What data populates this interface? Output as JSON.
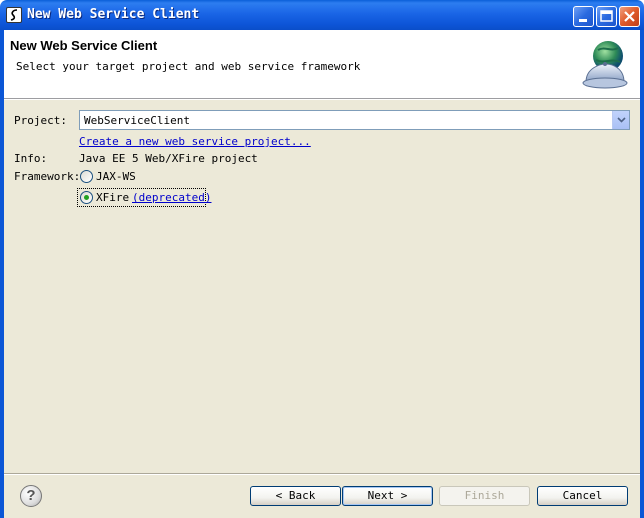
{
  "window": {
    "title": "New Web Service Client"
  },
  "header": {
    "title": "New Web Service Client",
    "description": "Select your target project and web service framework",
    "logo_icon": "globe-with-bell-icon"
  },
  "form": {
    "project_label": "Project:",
    "project_value": "WebServiceClient",
    "create_link": "Create a new web service project...",
    "info_label": "Info:",
    "info_value": "Java EE 5 Web/XFire project",
    "framework_label": "Framework:",
    "framework_options": [
      {
        "label": "JAX-WS",
        "checked": false
      },
      {
        "label": "XFire",
        "checked": true,
        "note": "(deprecated)"
      }
    ]
  },
  "footer": {
    "help_icon": "help-icon",
    "back_label": "< Back",
    "next_label": "Next >",
    "finish_label": "Finish",
    "cancel_label": "Cancel"
  },
  "colors": {
    "titlebar": "#0a5fd8",
    "dialog_bg": "#ece9d8",
    "link": "#0000cc",
    "radio_dot": "#21a121"
  }
}
